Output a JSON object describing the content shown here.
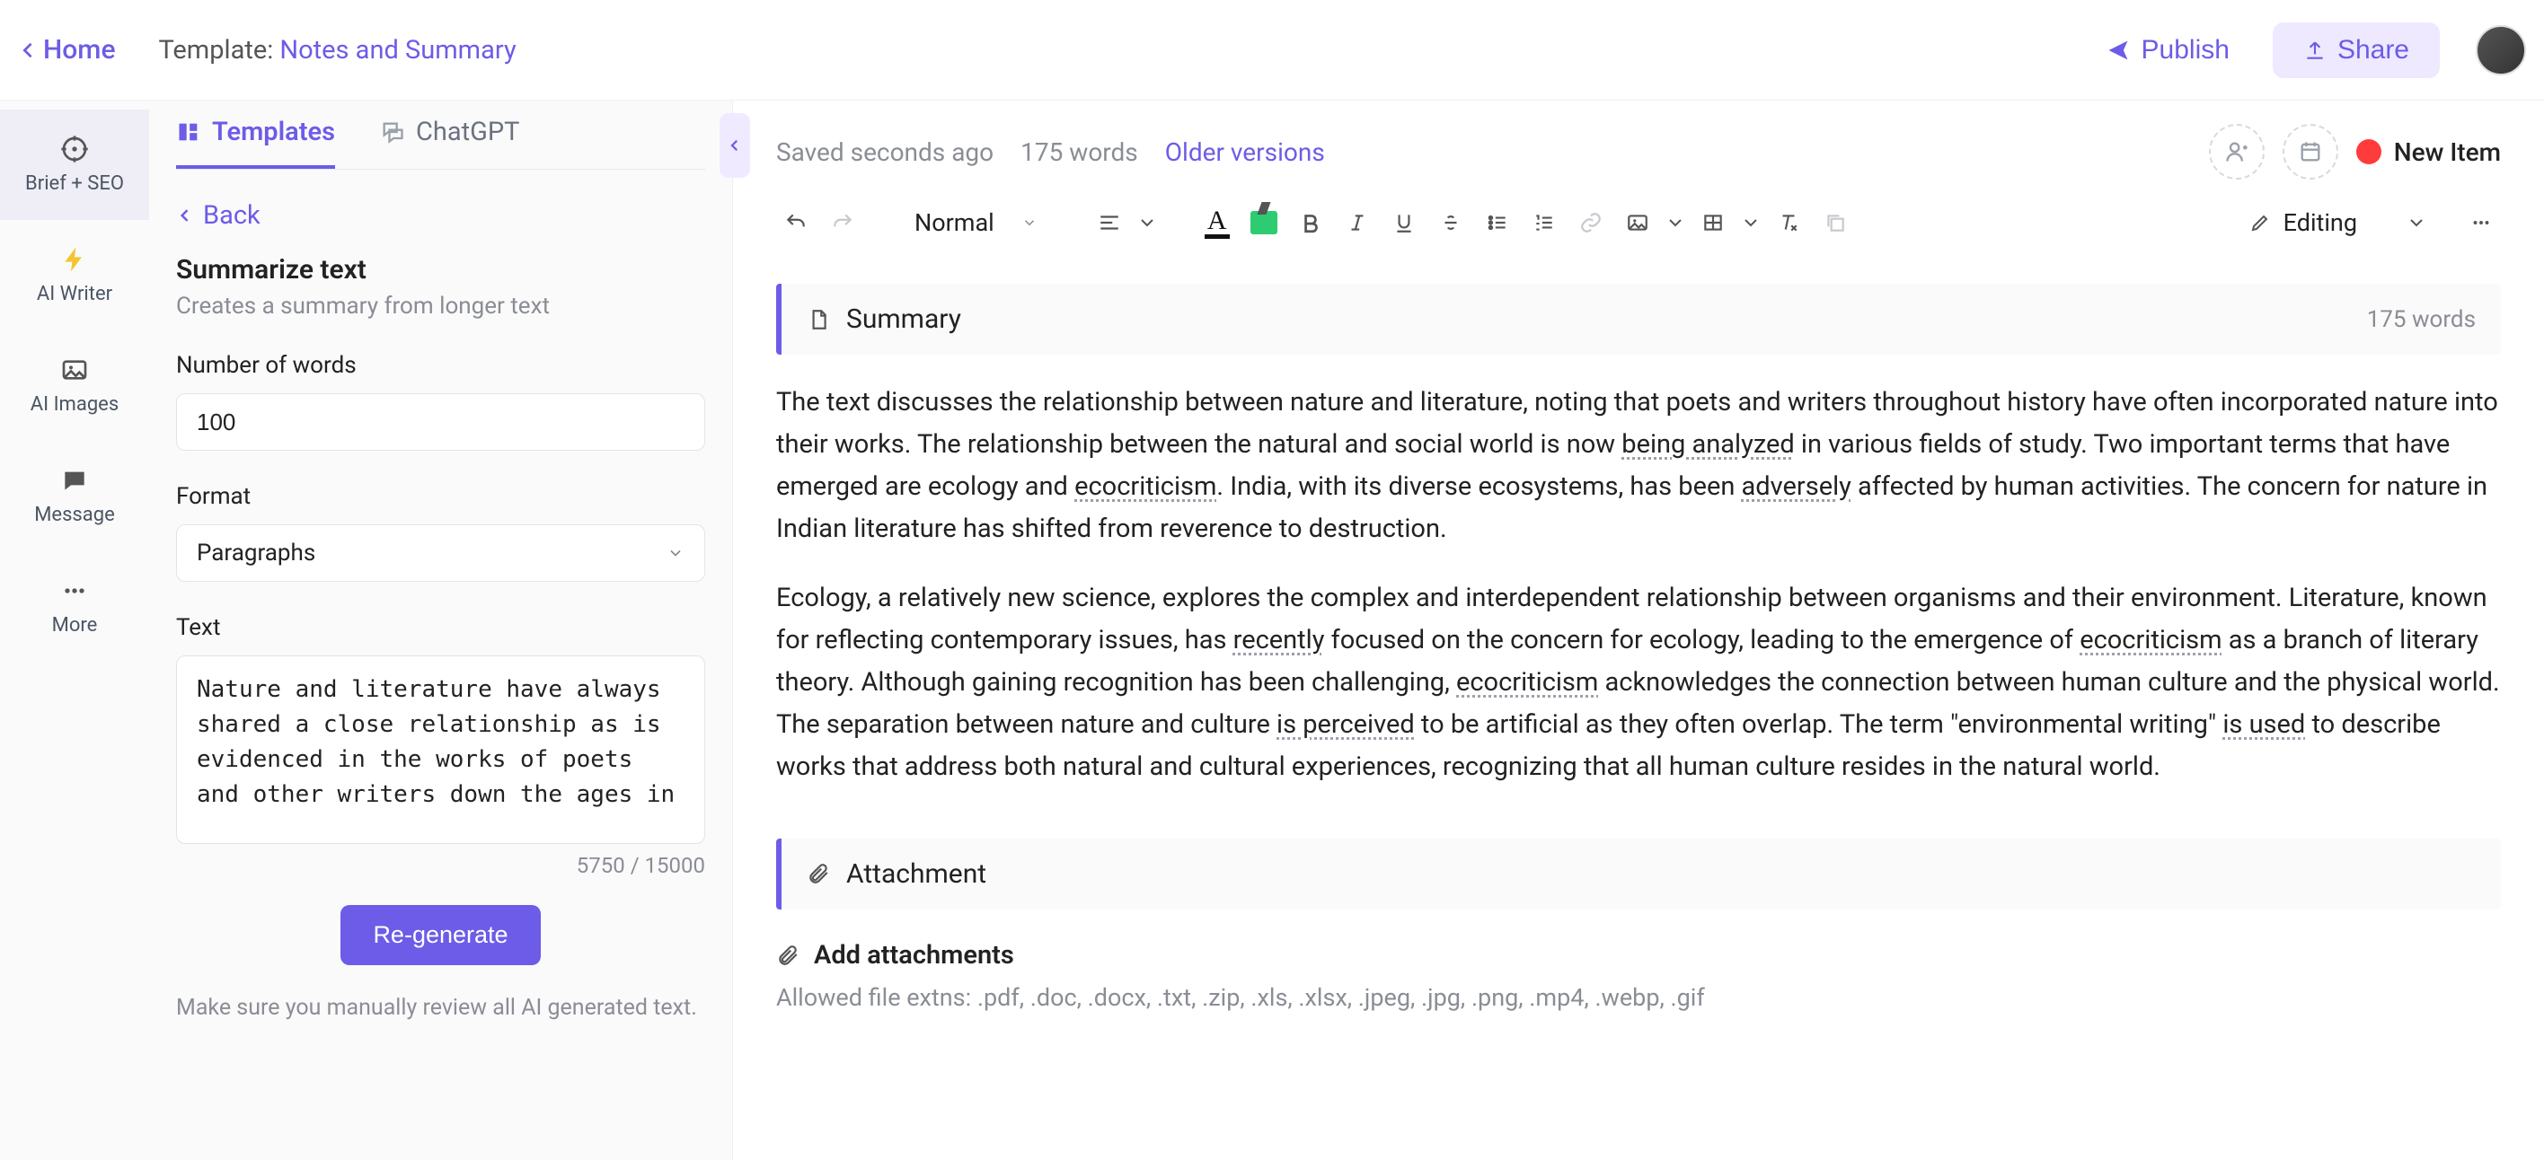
{
  "header": {
    "home": "Home",
    "template_prefix": "Template: ",
    "template_name": "Notes and Summary",
    "publish": "Publish",
    "share": "Share"
  },
  "leftnav": {
    "brief": "Brief + SEO",
    "writer": "AI Writer",
    "images": "AI Images",
    "message": "Message",
    "more": "More"
  },
  "sidepanel": {
    "tabs": {
      "templates": "Templates",
      "chatgpt": "ChatGPT"
    },
    "back": "Back",
    "title": "Summarize text",
    "subtitle": "Creates a summary from longer text",
    "num_words_label": "Number of words",
    "num_words_value": "100",
    "format_label": "Format",
    "format_value": "Paragraphs",
    "text_label": "Text",
    "text_value": "Nature and literature have always shared a close relationship as is\nevidenced in the works of poets and other writers down the ages in",
    "char_count": "5750 / 15000",
    "regenerate": "Re-generate",
    "note": "Make sure you manually review all AI generated text."
  },
  "status": {
    "saved": "Saved seconds ago",
    "words": "175 words",
    "older": "Older versions",
    "new_item": "New Item"
  },
  "toolbar": {
    "style": "Normal",
    "editing": "Editing"
  },
  "document": {
    "section_title": "Summary",
    "section_count": "175 words",
    "p1a": "The text discusses the relationship between nature and literature, noting that poets and writers throughout history have often incorporated nature into their works. The relationship between the natural and social world is now ",
    "p1u1": "being analyzed",
    "p1b": " in various fields of study. Two important terms that have emerged are ecology and ",
    "p1u2": "ecocriticism",
    "p1c": ". India, with its diverse ecosystems, has been ",
    "p1u3": "adversely",
    "p1d": " affected by human activities. The concern for nature in Indian literature has shifted from reverence to destruction.",
    "p2a": "Ecology, a relatively new science, explores the complex and interdependent relationship between organisms and their environment. Literature, known for reflecting contemporary issues, has ",
    "p2u1": "recently",
    "p2b": " focused on the concern for ecology, leading to the emergence of ",
    "p2u2": "ecocriticism",
    "p2c": " as a branch of literary theory. Although gaining recognition has been challenging, ",
    "p2u3": "ecocriticism",
    "p2d": " acknowledges the connection between human culture and the physical world. The separation between nature and culture ",
    "p2u4": "is perceived",
    "p2e": " to be artificial as they often overlap. The term \"environmental writing\" ",
    "p2u5": "is used",
    "p2f": " to describe works that address both natural and cultural experiences, recognizing that all human culture resides in the natural world.",
    "attach_title": "Attachment",
    "add_attach": "Add attachments",
    "ext_note": "Allowed file extns: .pdf, .doc, .docx, .txt, .zip, .xls, .xlsx, .jpeg, .jpg, .png, .mp4, .webp, .gif"
  }
}
